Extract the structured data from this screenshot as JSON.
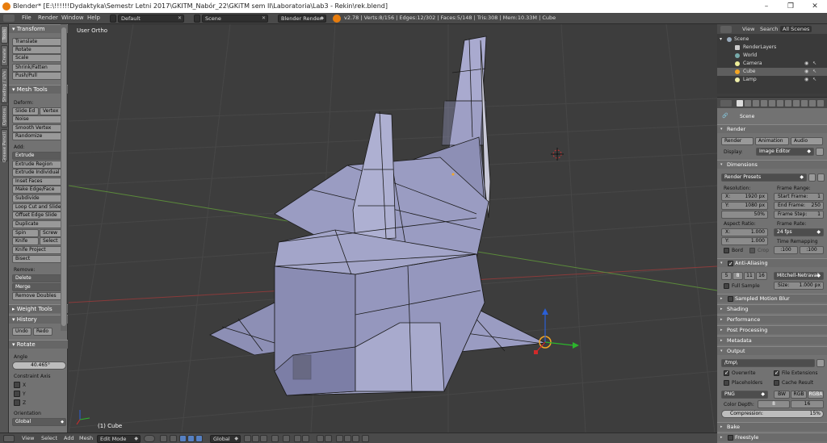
{
  "window": {
    "title": "Blender* [E:\\!!!!!!Dydaktyka\\Semestr Letni 2017\\GKITM_Nabór_22\\GKiTM sem II\\Laboratoria\\Lab3 - Rekin\\rek.blend]",
    "minimize": "–",
    "maximize": "❐",
    "close": "✕"
  },
  "infobar": {
    "menus": [
      "File",
      "Render",
      "Window",
      "Help"
    ],
    "layout": "Default",
    "scene": "Scene",
    "engine": "Blender Render",
    "stats": "v2.78 | Verts:8/156 | Edges:12/302 | Faces:5/148 | Tris:308 | Mem:10.33M | Cube"
  },
  "vertical_tabs": [
    "Tools",
    "Create",
    "Shading / UVs",
    "Options",
    "Grease Pencil"
  ],
  "toolshelf": {
    "transform": {
      "header": "Transform",
      "buttons": [
        "Translate",
        "Rotate",
        "Scale",
        "Shrink/Fatten",
        "Push/Pull"
      ]
    },
    "mesh_tools": {
      "header": "Mesh Tools",
      "deform_label": "Deform:",
      "deform_buttons": [
        "Slide Ed",
        "Vertex",
        "Noise",
        "Smooth Vertex",
        "Randomize"
      ],
      "add_label": "Add:",
      "extrude": "Extrude",
      "add_buttons": [
        "Extrude Region",
        "Extrude Individual",
        "Inset Faces",
        "Make Edge/Face",
        "Subdivide",
        "Loop Cut and Slide",
        "Offset Edge Slide",
        "Duplicate"
      ],
      "spin": "Spin",
      "screw": "Screw",
      "knife": "Knife",
      "select": "Select",
      "knife_project": "Knife Project",
      "bisect": "Bisect",
      "remove_label": "Remove:",
      "delete": "Delete",
      "merge": "Merge",
      "remove_doubles": "Remove Doubles"
    },
    "weight_tools": "Weight Tools",
    "history": {
      "header": "History",
      "undo": "Undo",
      "redo": "Redo"
    },
    "rotate": {
      "header": "Rotate",
      "angle_label": "Angle",
      "angle_value": "40.465°",
      "constraint_label": "Constraint Axis",
      "axes": [
        "X",
        "Y",
        "Z"
      ],
      "orientation_label": "Orientation",
      "orientation_value": "Global"
    }
  },
  "viewport": {
    "view_label": "User Ortho",
    "object_label": "(1) Cube",
    "colors": {
      "background": "#3d3d3d",
      "grid": "#474747",
      "x_axis": "#8a3b3b",
      "y_axis": "#5b8a3b",
      "mesh_face": "#9a9cc2",
      "mesh_edge": "#1a1a1a",
      "selection": "#f5a623"
    }
  },
  "bottombar": {
    "menus": [
      "View",
      "Select",
      "Add",
      "Mesh"
    ],
    "mode": "Edit Mode",
    "orientation": "Global"
  },
  "outliner": {
    "tabs": [
      "View",
      "Search",
      "All Scenes"
    ],
    "rows": [
      "Scene",
      "RenderLayers",
      "World",
      "Camera",
      "Cube",
      "Lamp"
    ]
  },
  "properties": {
    "scene_label": "Scene",
    "render": {
      "header": "Render",
      "render_btn": "Render",
      "animation_btn": "Animation",
      "audio_btn": "Audio",
      "display_label": "Display:",
      "display_value": "Image Editor"
    },
    "dimensions": {
      "header": "Dimensions",
      "presets": "Render Presets",
      "resolution_label": "Resolution:",
      "res_x": "X:",
      "res_x_val": "1920 px",
      "res_y": "Y:",
      "res_y_val": "1080 px",
      "res_pct": "50%",
      "frame_range_label": "Frame Range:",
      "start_frame": "Start Frame:",
      "start_frame_val": "1",
      "end_frame": "End Frame:",
      "end_frame_val": "250",
      "frame_step": "Frame Step:",
      "frame_step_val": "1",
      "aspect_label": "Aspect Ratio:",
      "aspect_x": "X:",
      "aspect_x_val": "1.000",
      "aspect_y": "Y:",
      "aspect_y_val": "1.000",
      "frame_rate_label": "Frame Rate:",
      "frame_rate_val": "24 fps",
      "time_remap_label": "Time Remapping",
      "remap_old": ":100",
      "remap_new": ":100",
      "bord": "Bord",
      "crop": "Crop"
    },
    "anti_aliasing": {
      "header": "Anti-Aliasing",
      "samples": [
        "5",
        "8",
        "11",
        "16"
      ],
      "filter": "Mitchell-Netravali",
      "full_sample": "Full Sample",
      "size_label": "Size:",
      "size_val": "1.000 px"
    },
    "collapsed": [
      "Sampled Motion Blur",
      "Shading",
      "Performance",
      "Post Processing",
      "Metadata"
    ],
    "output": {
      "header": "Output",
      "path": "/tmp\\",
      "overwrite": "Overwrite",
      "file_extensions": "File Extensions",
      "placeholders": "Placeholders",
      "cache_result": "Cache Result",
      "format": "PNG",
      "bw": "BW",
      "rgb": "RGB",
      "rgba": "RGBA",
      "color_depth_label": "Color Depth:",
      "depth_8": "8",
      "depth_16": "16",
      "compression_label": "Compression:",
      "compression_val": "15%"
    },
    "bake": "Bake",
    "freestyle": "Freestyle"
  }
}
